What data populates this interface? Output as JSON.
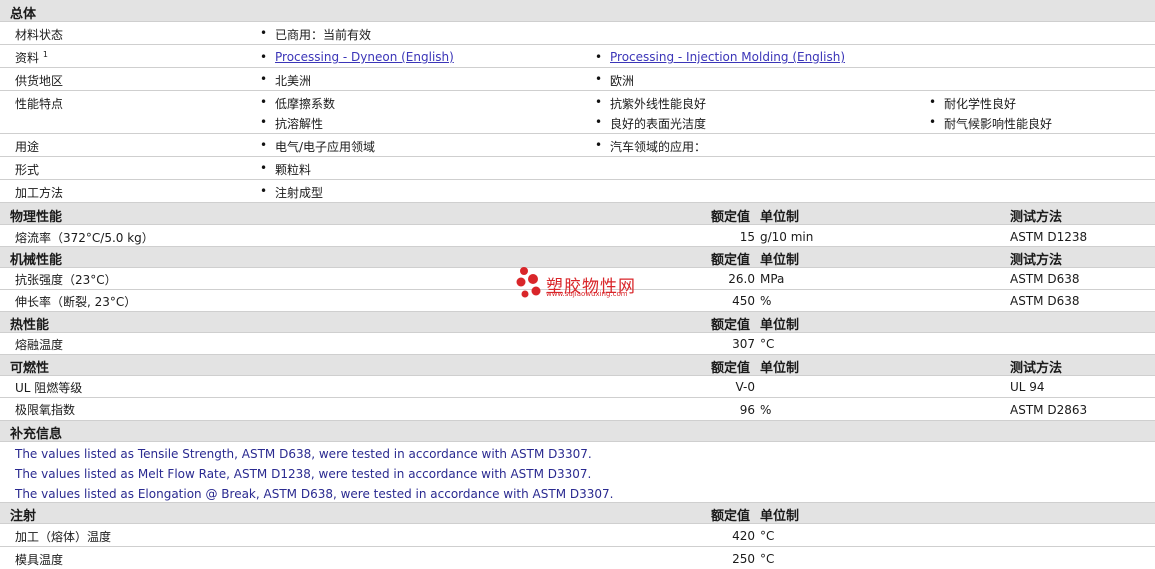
{
  "general": {
    "header": "总体",
    "material_status": {
      "label": "材料状态",
      "value": "已商用：当前有效"
    },
    "documents": {
      "label": "资料",
      "sup": "1",
      "links": [
        "Processing - Dyneon (English)",
        "Processing - Injection Molding (English)"
      ]
    },
    "supply_region": {
      "label": "供货地区",
      "values": [
        "北美洲",
        "欧洲"
      ]
    },
    "features": {
      "label": "性能特点",
      "values": [
        "低摩擦系数",
        "抗紫外线性能良好",
        "耐化学性良好",
        "抗溶解性",
        "良好的表面光洁度",
        "耐气候影响性能良好"
      ]
    },
    "uses": {
      "label": "用途",
      "values": [
        "电气/电子应用领域",
        "汽车领域的应用："
      ]
    },
    "form": {
      "label": "形式",
      "value": "颗粒料"
    },
    "processing": {
      "label": "加工方法",
      "value": "注射成型"
    }
  },
  "columns": {
    "nominal": "额定值",
    "unit": "单位制",
    "method": "测试方法"
  },
  "physical": {
    "header": "物理性能",
    "rows": [
      {
        "name": "熔流率（372°C/5.0 kg）",
        "value": "15",
        "unit": "g/10 min",
        "method": "ASTM D1238"
      }
    ]
  },
  "mechanical": {
    "header": "机械性能",
    "rows": [
      {
        "name": "抗张强度（23°C）",
        "value": "26.0",
        "unit": "MPa",
        "method": "ASTM D638"
      },
      {
        "name": "伸长率（断裂, 23°C）",
        "value": "450",
        "unit": "%",
        "method": "ASTM D638"
      }
    ]
  },
  "thermal": {
    "header": "热性能",
    "rows": [
      {
        "name": "熔融温度",
        "value": "307",
        "unit": "°C",
        "method": ""
      }
    ]
  },
  "flammability": {
    "header": "可燃性",
    "rows": [
      {
        "name": "UL 阻燃等级",
        "value": "V-0",
        "unit": "",
        "method": "UL 94"
      },
      {
        "name": "极限氧指数",
        "value": "96",
        "unit": "%",
        "method": "ASTM D2863"
      }
    ]
  },
  "supplementary": {
    "header": "补充信息",
    "notes": [
      "The values listed as Tensile Strength, ASTM D638, were tested in accordance with ASTM D3307.",
      "The values listed as Melt Flow Rate, ASTM D1238, were tested in accordance with ASTM D3307.",
      "The values listed as Elongation @ Break, ASTM D638, were tested in accordance with ASTM D3307."
    ]
  },
  "injection": {
    "header": "注射",
    "rows": [
      {
        "name": "加工（熔体）温度",
        "value": "420",
        "unit": "°C"
      },
      {
        "name": "模具温度",
        "value": "250",
        "unit": "°C"
      }
    ]
  },
  "watermark": {
    "title": "塑胶物性网",
    "url": "www.sujiaowuxing.com",
    "color": "#d9262a"
  }
}
